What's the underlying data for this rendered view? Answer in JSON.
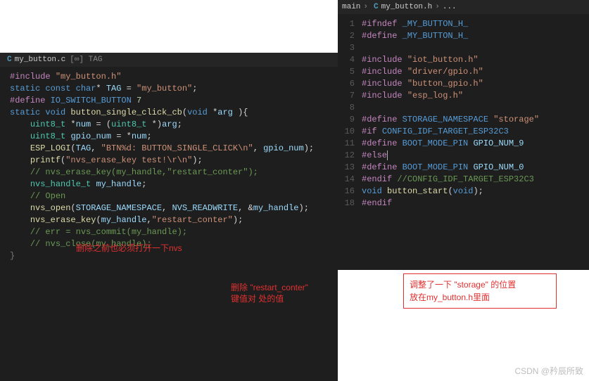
{
  "left": {
    "tab": {
      "icon": "C",
      "name": "my_button.c",
      "sub": "[∞] TAG"
    },
    "lines": [
      [
        [
          "mg",
          "#include "
        ],
        [
          "st",
          "\"my_button.h\""
        ]
      ],
      [
        [
          "op",
          ""
        ]
      ],
      [
        [
          "bl",
          "static const char"
        ],
        [
          "op",
          "* "
        ],
        [
          "vr",
          "TAG"
        ],
        [
          "op",
          " = "
        ],
        [
          "st",
          "\"my_button\""
        ],
        [
          "op",
          ";"
        ]
      ],
      [
        [
          "mg",
          "#define "
        ],
        [
          "bl",
          "IO_SWITCH_BUTTON "
        ],
        [
          "nm",
          "7"
        ]
      ],
      [
        [
          "op",
          ""
        ]
      ],
      [
        [
          "bl",
          "static void "
        ],
        [
          "fn",
          "button_single_click_cb"
        ],
        [
          "op",
          "("
        ],
        [
          "bl",
          "void "
        ],
        [
          "op",
          "*"
        ],
        [
          "vr",
          "arg"
        ],
        [
          "op",
          " ){"
        ]
      ],
      [
        [
          "op",
          ""
        ]
      ],
      [
        [
          "op",
          "    "
        ],
        [
          "ty",
          "uint8_t"
        ],
        [
          "op",
          " *"
        ],
        [
          "vr",
          "num"
        ],
        [
          "op",
          " = ("
        ],
        [
          "ty",
          "uint8_t"
        ],
        [
          "op",
          " *)"
        ],
        [
          "vr",
          "arg"
        ],
        [
          "op",
          ";"
        ]
      ],
      [
        [
          "op",
          "    "
        ],
        [
          "ty",
          "uint8_t"
        ],
        [
          "op",
          " "
        ],
        [
          "vr",
          "gpio_num"
        ],
        [
          "op",
          " = *"
        ],
        [
          "vr",
          "num"
        ],
        [
          "op",
          ";"
        ]
      ],
      [
        [
          "op",
          "    "
        ],
        [
          "fn",
          "ESP_LOGI"
        ],
        [
          "op",
          "("
        ],
        [
          "vr",
          "TAG"
        ],
        [
          "op",
          ", "
        ],
        [
          "st",
          "\"BTN%d: BUTTON_SINGLE_CLICK\\n\""
        ],
        [
          "op",
          ", "
        ],
        [
          "vr",
          "gpio_num"
        ],
        [
          "op",
          ");"
        ]
      ],
      [
        [
          "op",
          "    "
        ],
        [
          "fn",
          "printf"
        ],
        [
          "op",
          "("
        ],
        [
          "st",
          "\"nvs_erase_key test!\\r\\n\""
        ],
        [
          "op",
          ");"
        ]
      ],
      [
        [
          "op",
          "    "
        ],
        [
          "cm",
          "// nvs_erase_key(my_handle,\"restart_conter\");"
        ]
      ],
      [
        [
          "op",
          "    "
        ],
        [
          "ty",
          "nvs_handle_t"
        ],
        [
          "op",
          " "
        ],
        [
          "vr",
          "my_handle"
        ],
        [
          "op",
          ";"
        ]
      ],
      [
        [
          "op",
          ""
        ]
      ],
      [
        [
          "op",
          "    "
        ],
        [
          "cm",
          "// Open"
        ]
      ],
      [
        [
          "op",
          "    "
        ],
        [
          "fn",
          "nvs_open"
        ],
        [
          "op",
          "("
        ],
        [
          "vr",
          "STORAGE_NAMESPACE"
        ],
        [
          "op",
          ", "
        ],
        [
          "vr",
          "NVS_READWRITE"
        ],
        [
          "op",
          ", &"
        ],
        [
          "vr",
          "my_handle"
        ],
        [
          "op",
          ");"
        ]
      ],
      [
        [
          "op",
          ""
        ]
      ],
      [
        [
          "op",
          "    "
        ],
        [
          "fn",
          "nvs_erase_key"
        ],
        [
          "op",
          "("
        ],
        [
          "vr",
          "my_handle"
        ],
        [
          "op",
          ","
        ],
        [
          "st",
          "\"restart_conter\""
        ],
        [
          "op",
          ");"
        ]
      ],
      [
        [
          "op",
          ""
        ]
      ],
      [
        [
          "op",
          "    "
        ],
        [
          "cm",
          "// err = nvs_commit(my_handle);"
        ]
      ],
      [
        [
          "op",
          ""
        ]
      ],
      [
        [
          "op",
          "    "
        ],
        [
          "cm",
          "// nvs_close(my_handle);"
        ]
      ],
      [
        [
          "op",
          ""
        ]
      ],
      [
        [
          "dim",
          "}"
        ]
      ]
    ],
    "annotations": {
      "open_note": "删除之前也必须打开一下nvs",
      "erase_note_l1": "删除 \"restart_conter\"",
      "erase_note_l2": "键值对 处的值"
    }
  },
  "right": {
    "breadcrumb": {
      "folder": "main",
      "icon": "C",
      "file": "my_button.h",
      "more": "..."
    },
    "lines": [
      {
        "n": "1",
        "t": [
          [
            "mg",
            "#ifndef "
          ],
          [
            "bl",
            "_MY_BUTTON_H_"
          ]
        ]
      },
      {
        "n": "2",
        "t": [
          [
            "mg",
            "#define "
          ],
          [
            "bl",
            "_MY_BUTTON_H_"
          ]
        ]
      },
      {
        "n": "3",
        "t": [
          [
            "op",
            ""
          ]
        ]
      },
      {
        "n": "4",
        "t": [
          [
            "mg",
            "#include "
          ],
          [
            "st",
            "\"iot_button.h\""
          ]
        ]
      },
      {
        "n": "5",
        "t": [
          [
            "mg",
            "#include "
          ],
          [
            "st",
            "\"driver/gpio.h\""
          ]
        ]
      },
      {
        "n": "6",
        "t": [
          [
            "mg",
            "#include "
          ],
          [
            "st",
            "\"button_gpio.h\""
          ]
        ]
      },
      {
        "n": "7",
        "t": [
          [
            "mg",
            "#include "
          ],
          [
            "st",
            "\"esp_log.h\""
          ]
        ]
      },
      {
        "n": "8",
        "t": [
          [
            "op",
            ""
          ]
        ]
      },
      {
        "n": "9",
        "t": [
          [
            "mg",
            "#define "
          ],
          [
            "bl",
            "STORAGE_NAMESPACE "
          ],
          [
            "st",
            "\"storage\""
          ]
        ]
      },
      {
        "n": "10",
        "t": [
          [
            "mg",
            "#if "
          ],
          [
            "bl",
            "CONFIG_IDF_TARGET_ESP32C3"
          ]
        ]
      },
      {
        "n": "11",
        "t": [
          [
            "mg",
            "#define "
          ],
          [
            "bl",
            "BOOT_MODE_PIN "
          ],
          [
            "vr",
            "GPIO_NUM_9"
          ]
        ]
      },
      {
        "n": "12",
        "t": [
          [
            "mg",
            "#else"
          ]
        ],
        "cursor": true
      },
      {
        "n": "13",
        "t": [
          [
            "mg",
            "#define "
          ],
          [
            "bl",
            "BOOT_MODE_PIN "
          ],
          [
            "vr",
            "GPIO_NUM_0"
          ]
        ]
      },
      {
        "n": "14",
        "t": [
          [
            "mg",
            "#endif "
          ],
          [
            "cm",
            "//CONFIG_IDF_TARGET_ESP32C3"
          ]
        ]
      },
      {
        "n": "",
        "t": [
          [
            "op",
            ""
          ]
        ]
      },
      {
        "n": "16",
        "t": [
          [
            "bl",
            "void "
          ],
          [
            "fn",
            "button_start"
          ],
          [
            "op",
            "("
          ],
          [
            "bl",
            "void"
          ],
          [
            "op",
            ");"
          ]
        ]
      },
      {
        "n": "",
        "t": [
          [
            "op",
            ""
          ]
        ]
      },
      {
        "n": "18",
        "t": [
          [
            "mg",
            "#endif"
          ]
        ]
      }
    ],
    "note": {
      "l1": "调整了一下 \"storage\" 的位置",
      "l2": "放在my_button.h里面"
    }
  },
  "watermark": "CSDN @矜辰所致"
}
